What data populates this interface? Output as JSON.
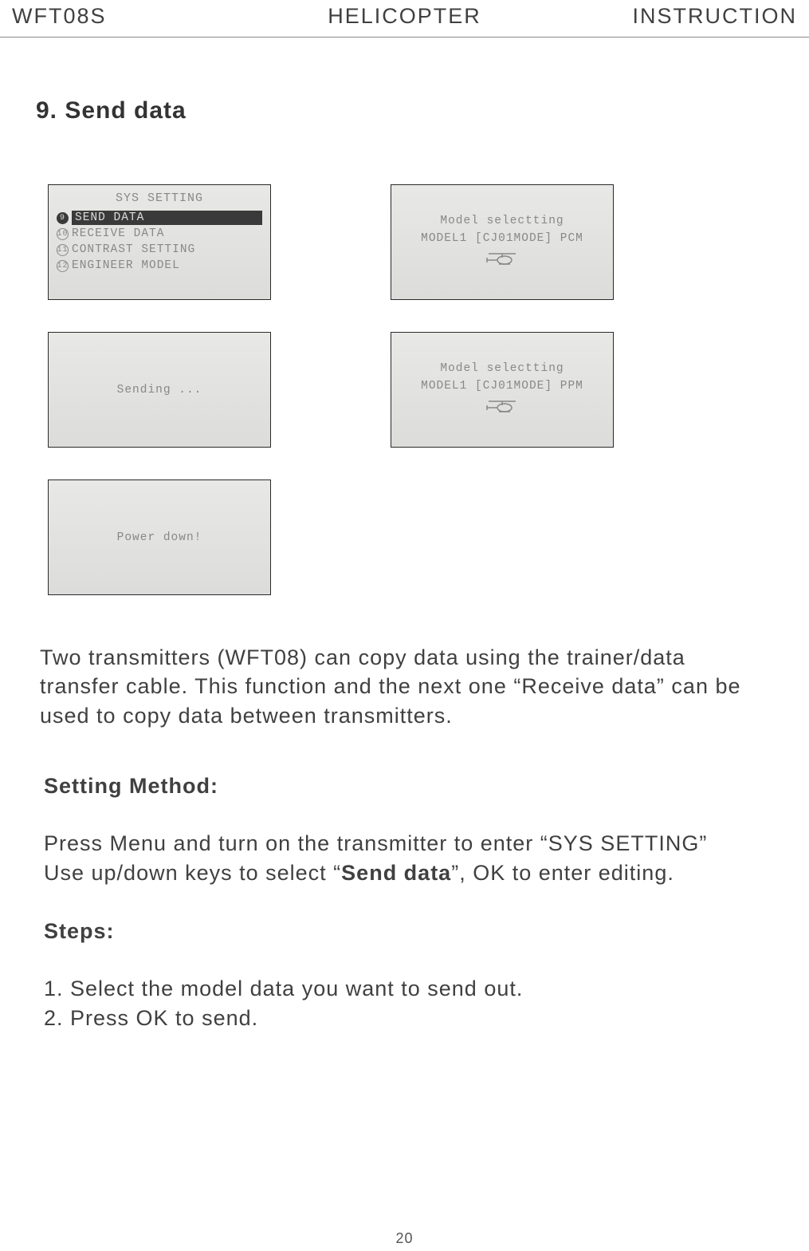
{
  "header": {
    "left": "WFT08S",
    "center": "HELICOPTER",
    "right": "INSTRUCTION"
  },
  "section_title": "9. Send data",
  "screens": {
    "sys_setting": {
      "title": "SYS SETTING",
      "items": [
        {
          "num": "9",
          "label": "SEND DATA",
          "selected": true
        },
        {
          "num": "10",
          "label": "RECEIVE DATA",
          "selected": false
        },
        {
          "num": "11",
          "label": "CONTRAST SETTING",
          "selected": false
        },
        {
          "num": "12",
          "label": "ENGINEER MODEL",
          "selected": false
        }
      ]
    },
    "selecting_pcm": {
      "title": "Model selectting",
      "line": "MODEL1 [CJ01MODE] PCM"
    },
    "sending": {
      "line": "Sending ..."
    },
    "selecting_ppm": {
      "title": "Model selectting",
      "line": "MODEL1 [CJ01MODE] PPM"
    },
    "power_down": {
      "line": "Power down!"
    }
  },
  "intro_text": "Two transmitters (WFT08) can copy data using the trainer/data transfer cable. This function and the next one “Receive data” can be used to copy data between transmitters.",
  "setting_method_title": "Setting Method:",
  "setting_method_lines": {
    "line1_prefix": "Press Menu and turn on the transmitter to enter “SYS SETTING”",
    "line2_prefix": "Use up/down keys to select “",
    "line2_bold": "Send data",
    "line2_suffix": "”, OK to enter editing."
  },
  "steps_title": "Steps:",
  "steps": [
    "1. Select the model data you want to send out.",
    "2. Press OK to send."
  ],
  "page_number": "20"
}
